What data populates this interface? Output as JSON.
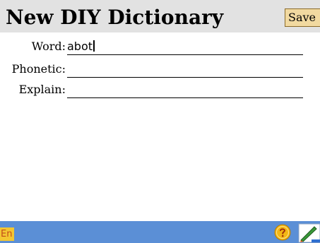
{
  "header": {
    "title": "New DIY Dictionary",
    "save_label": "Save"
  },
  "form": {
    "fields": [
      {
        "label": "Word:",
        "value": "abot"
      },
      {
        "label": "Phonetic:",
        "value": ""
      },
      {
        "label": "Explain:",
        "value": ""
      }
    ]
  },
  "status_bar": {
    "lang": "En",
    "help_icon": "question-icon",
    "pen_icon": "pen-icon"
  },
  "colors": {
    "header_bg": "#e2e2e2",
    "save_bg": "#f1d9a0",
    "status_bg": "#5b8fd6",
    "lang_bg": "#f3c631",
    "help_yellow": "#f3b715"
  }
}
